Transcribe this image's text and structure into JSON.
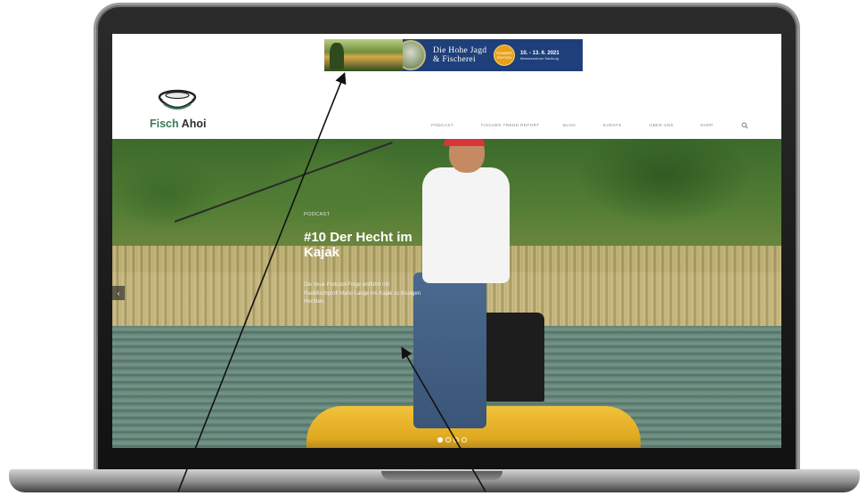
{
  "ad": {
    "title_line1": "Die Hohe Jagd",
    "title_line2": "& Fischerei",
    "badge": "SOMMER EDITION",
    "dates": "10. - 13. 6. 2021",
    "venue": "Messezentrum Salzburg"
  },
  "logo": {
    "text_part1": "Fisch",
    "text_part2": "Ahoi"
  },
  "nav": {
    "items": [
      {
        "label": "PODCAST"
      },
      {
        "label": "FISCHER TREND REPORT"
      },
      {
        "label": "BLOG"
      },
      {
        "label": "EVENTS"
      },
      {
        "label": "ÜBER UNS"
      },
      {
        "label": "SHOP"
      }
    ],
    "search_icon": "search-icon"
  },
  "hero": {
    "category": "PODCAST",
    "title": "#10 Der Hecht im Kajak",
    "description": "Die neue Podcast-Folge entführt mit Raubfischprofi Mario Lange ins Kajak zu bissigen Hechten.",
    "prev_icon": "‹",
    "slide_count": 4,
    "active_slide": 1
  },
  "colors": {
    "brand_green": "#3b7a57",
    "ad_blue": "#1f3f7a",
    "nav_text": "#8a8a8a"
  }
}
